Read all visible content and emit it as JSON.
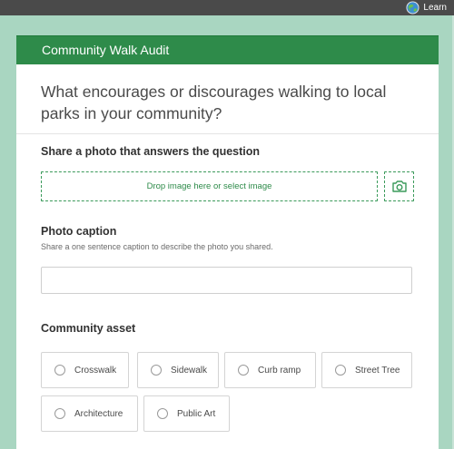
{
  "topbar": {
    "learn_label": "Learn",
    "globe_icon": "globe-icon"
  },
  "form": {
    "title": "Community Walk Audit",
    "question": "What encourages or discourages walking to local parks in your community?",
    "photo": {
      "label": "Share a photo that answers the question",
      "dropzone_text": "Drop image here or select image",
      "camera_icon": "camera-icon"
    },
    "caption": {
      "label": "Photo caption",
      "hint": "Share a one sentence caption to describe the photo you shared.",
      "value": "",
      "placeholder": ""
    },
    "asset": {
      "label": "Community asset",
      "options": [
        "Crosswalk",
        "Sidewalk",
        "Curb ramp",
        "Street Tree",
        "Architecture",
        "Public Art"
      ],
      "selected": null
    }
  },
  "colors": {
    "header_green": "#2e8b4a",
    "background_mint": "#a9d6c1",
    "topbar": "#4a4a4a"
  }
}
